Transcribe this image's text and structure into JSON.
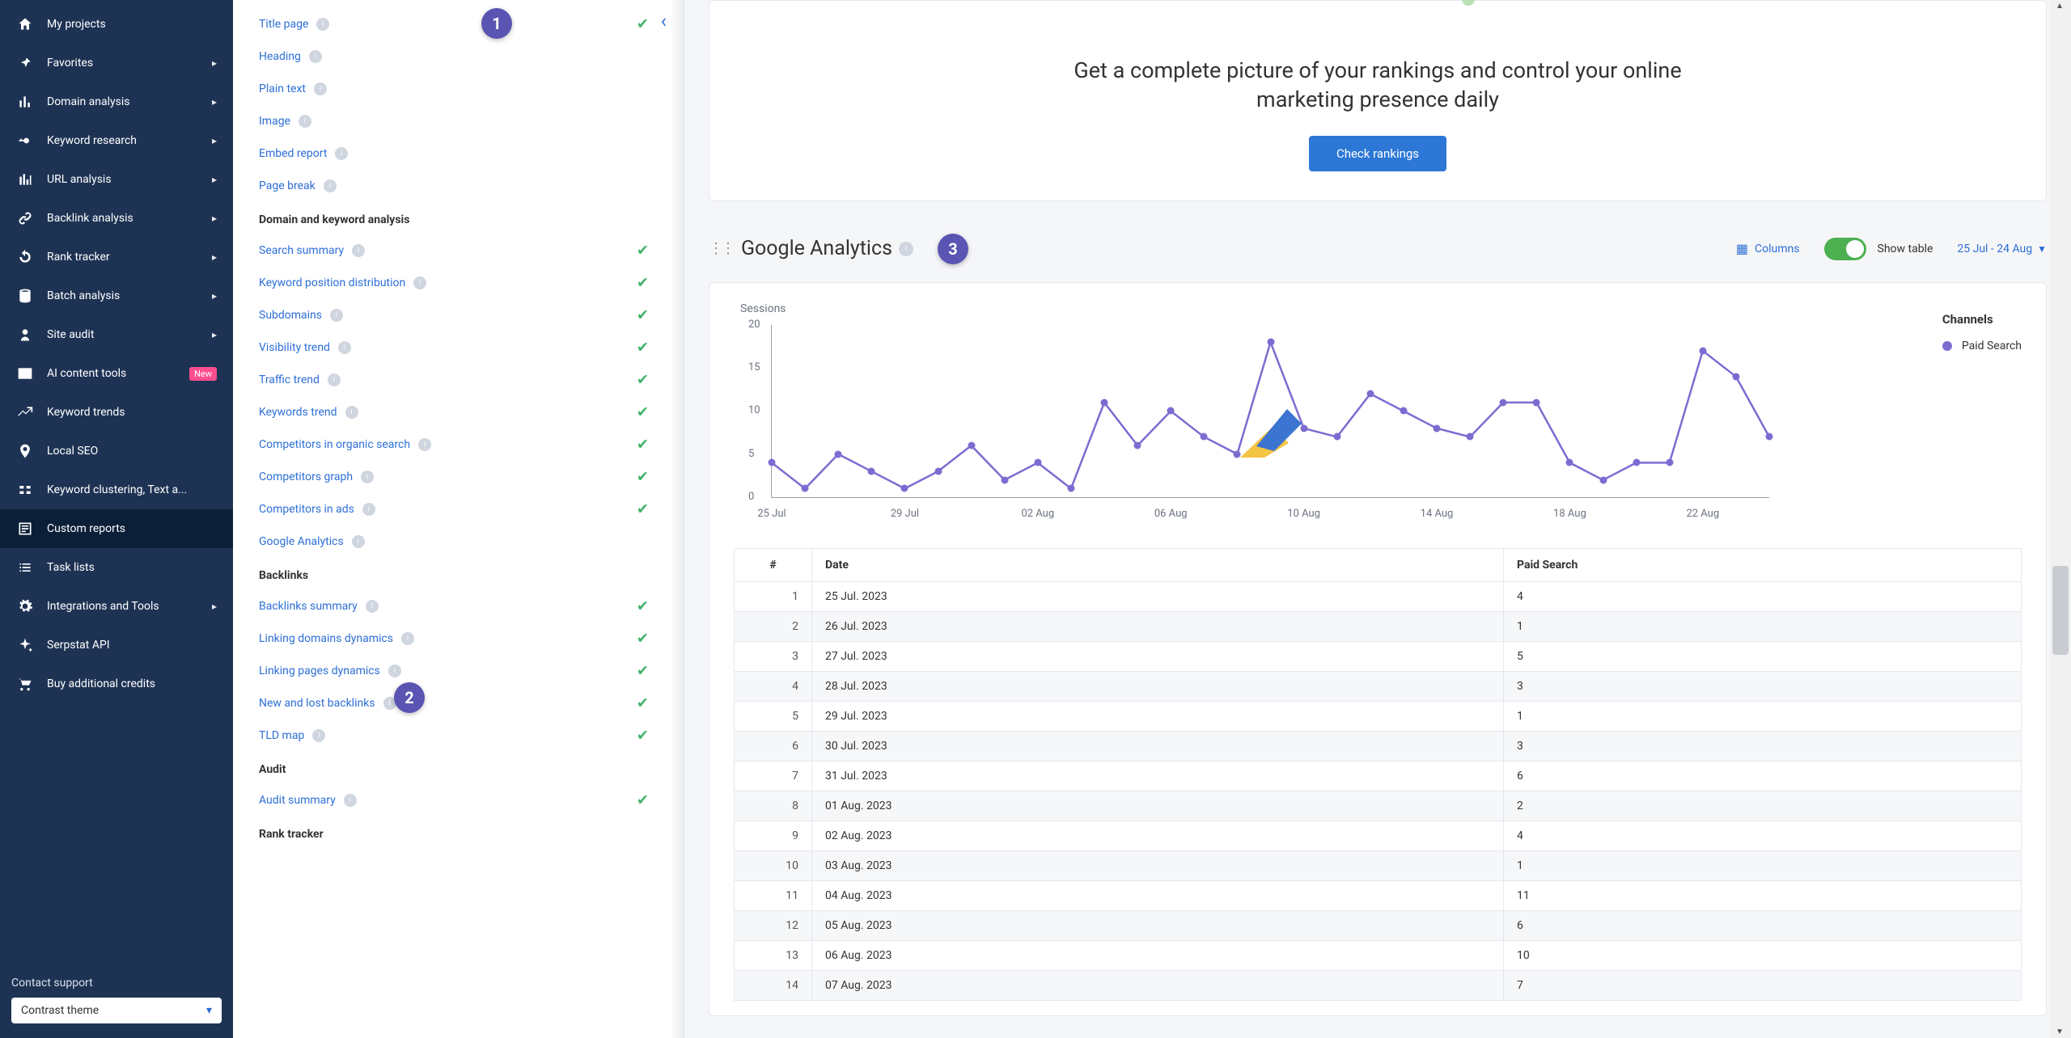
{
  "sidebar": {
    "items": [
      {
        "label": "My projects",
        "icon": "home",
        "expandable": false
      },
      {
        "label": "Favorites",
        "icon": "pin",
        "expandable": true
      },
      {
        "label": "Domain analysis",
        "icon": "chart-bars",
        "expandable": true
      },
      {
        "label": "Keyword research",
        "icon": "key",
        "expandable": true
      },
      {
        "label": "URL analysis",
        "icon": "bars",
        "expandable": true
      },
      {
        "label": "Backlink analysis",
        "icon": "link",
        "expandable": true
      },
      {
        "label": "Rank tracker",
        "icon": "refresh",
        "expandable": true
      },
      {
        "label": "Batch analysis",
        "icon": "database",
        "expandable": true
      },
      {
        "label": "Site audit",
        "icon": "users",
        "expandable": true
      },
      {
        "label": "AI content tools",
        "icon": "window",
        "expandable": false,
        "badge": "New"
      },
      {
        "label": "Keyword trends",
        "icon": "trend",
        "expandable": false
      },
      {
        "label": "Local SEO",
        "icon": "pin-loc",
        "expandable": false
      },
      {
        "label": "Keyword clustering, Text a...",
        "icon": "flow",
        "expandable": false
      },
      {
        "label": "Custom reports",
        "icon": "report",
        "expandable": false,
        "active": true
      },
      {
        "label": "Task lists",
        "icon": "list",
        "expandable": false
      },
      {
        "label": "Integrations and Tools",
        "icon": "gear",
        "expandable": true
      },
      {
        "label": "Serpstat API",
        "icon": "sparkle",
        "expandable": false
      },
      {
        "label": "Buy additional credits",
        "icon": "cart",
        "expandable": false
      }
    ],
    "contact_label": "Contact support",
    "theme_value": "Contrast theme"
  },
  "widgets": {
    "basic": [
      {
        "label": "Title page",
        "checked": true
      },
      {
        "label": "Heading",
        "checked": false
      },
      {
        "label": "Plain text",
        "checked": false
      },
      {
        "label": "Image",
        "checked": false
      },
      {
        "label": "Embed report",
        "checked": false
      },
      {
        "label": "Page break",
        "checked": false
      }
    ],
    "sections": [
      {
        "heading": "Domain and keyword analysis",
        "items": [
          {
            "label": "Search summary",
            "checked": true
          },
          {
            "label": "Keyword position distribution",
            "checked": true
          },
          {
            "label": "Subdomains",
            "checked": true
          },
          {
            "label": "Visibility trend",
            "checked": true
          },
          {
            "label": "Traffic trend",
            "checked": true
          },
          {
            "label": "Keywords trend",
            "checked": true
          },
          {
            "label": "Competitors in organic search",
            "checked": true
          },
          {
            "label": "Competitors graph",
            "checked": true
          },
          {
            "label": "Competitors in ads",
            "checked": true
          },
          {
            "label": "Google Analytics",
            "checked": false
          }
        ]
      },
      {
        "heading": "Backlinks",
        "items": [
          {
            "label": "Backlinks summary",
            "checked": true
          },
          {
            "label": "Linking domains dynamics",
            "checked": true
          },
          {
            "label": "Linking pages dynamics",
            "checked": true
          },
          {
            "label": "New and lost backlinks",
            "checked": true
          },
          {
            "label": "TLD map",
            "checked": true
          }
        ]
      },
      {
        "heading": "Audit",
        "items": [
          {
            "label": "Audit summary",
            "checked": true
          }
        ]
      },
      {
        "heading": "Rank tracker",
        "items": []
      }
    ]
  },
  "annotations": {
    "b1": "1",
    "b2": "2",
    "b3": "3"
  },
  "promo": {
    "title": "Get a complete picture of your rankings and control your online marketing presence daily",
    "cta": "Check rankings"
  },
  "ga": {
    "title": "Google Analytics",
    "columns_btn": "Columns",
    "show_table": "Show table",
    "date_range": "25 Jul - 24 Aug",
    "legend_heading": "Channels",
    "legend_item": "Paid Search",
    "legend_color": "#7e6bd1",
    "ylabel": "Sessions",
    "table_headers": [
      "#",
      "Date",
      "Paid Search"
    ]
  },
  "chart_data": {
    "type": "line",
    "title": "Sessions",
    "xlabel": "",
    "ylabel": "Sessions",
    "ylim": [
      0,
      20
    ],
    "yticks": [
      0,
      5,
      10,
      15,
      20
    ],
    "xticks": [
      "25 Jul",
      "29 Jul",
      "02 Aug",
      "06 Aug",
      "10 Aug",
      "14 Aug",
      "18 Aug",
      "22 Aug"
    ],
    "series": [
      {
        "name": "Paid Search",
        "color": "#7e6bd1",
        "x": [
          "25 Jul",
          "26 Jul",
          "27 Jul",
          "28 Jul",
          "29 Jul",
          "30 Jul",
          "31 Jul",
          "01 Aug",
          "02 Aug",
          "03 Aug",
          "04 Aug",
          "05 Aug",
          "06 Aug",
          "07 Aug",
          "08 Aug",
          "09 Aug",
          "10 Aug",
          "11 Aug",
          "12 Aug",
          "13 Aug",
          "14 Aug",
          "15 Aug",
          "16 Aug",
          "17 Aug",
          "18 Aug",
          "19 Aug",
          "20 Aug",
          "21 Aug",
          "22 Aug",
          "23 Aug",
          "24 Aug"
        ],
        "values": [
          4,
          1,
          5,
          3,
          1,
          3,
          6,
          2,
          4,
          1,
          11,
          6,
          10,
          7,
          5,
          18,
          8,
          7,
          12,
          10,
          8,
          7,
          11,
          11,
          4,
          2,
          4,
          4,
          17,
          14,
          7
        ]
      }
    ]
  },
  "table_rows": [
    {
      "n": 1,
      "date": "25 Jul. 2023",
      "paid": 4
    },
    {
      "n": 2,
      "date": "26 Jul. 2023",
      "paid": 1
    },
    {
      "n": 3,
      "date": "27 Jul. 2023",
      "paid": 5
    },
    {
      "n": 4,
      "date": "28 Jul. 2023",
      "paid": 3
    },
    {
      "n": 5,
      "date": "29 Jul. 2023",
      "paid": 1
    },
    {
      "n": 6,
      "date": "30 Jul. 2023",
      "paid": 3
    },
    {
      "n": 7,
      "date": "31 Jul. 2023",
      "paid": 6
    },
    {
      "n": 8,
      "date": "01 Aug. 2023",
      "paid": 2
    },
    {
      "n": 9,
      "date": "02 Aug. 2023",
      "paid": 4
    },
    {
      "n": 10,
      "date": "03 Aug. 2023",
      "paid": 1
    },
    {
      "n": 11,
      "date": "04 Aug. 2023",
      "paid": 11
    },
    {
      "n": 12,
      "date": "05 Aug. 2023",
      "paid": 6
    },
    {
      "n": 13,
      "date": "06 Aug. 2023",
      "paid": 10
    },
    {
      "n": 14,
      "date": "07 Aug. 2023",
      "paid": 7
    }
  ]
}
